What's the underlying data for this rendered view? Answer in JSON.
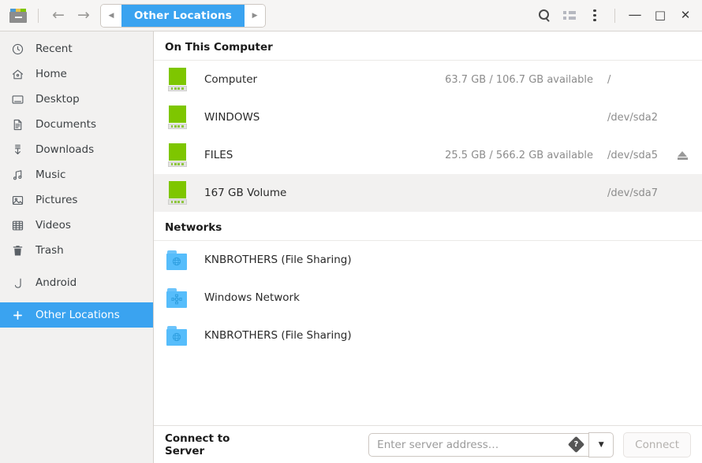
{
  "header": {
    "cabinet_icon": "file-cabinet-icon",
    "cabinet_tab_colors": [
      "#4a9ad4",
      "#e8c34a",
      "#7ec600"
    ],
    "back_arrow": "←",
    "forward_arrow": "→",
    "path_prev": "◀",
    "path_next": "▶",
    "breadcrumb": "Other Locations",
    "search_icon": "search-icon",
    "list_icon": "list-view-icon",
    "menu_icon": "menu-dots-icon",
    "minimize": "—",
    "maximize": "□",
    "close": "✕"
  },
  "sidebar": {
    "items": [
      {
        "label": "Recent",
        "icon": "clock-icon",
        "selected": false
      },
      {
        "label": "Home",
        "icon": "home-icon",
        "selected": false
      },
      {
        "label": "Desktop",
        "icon": "desktop-icon",
        "selected": false
      },
      {
        "label": "Documents",
        "icon": "document-icon",
        "selected": false
      },
      {
        "label": "Downloads",
        "icon": "download-icon",
        "selected": false
      },
      {
        "label": "Music",
        "icon": "music-icon",
        "selected": false
      },
      {
        "label": "Pictures",
        "icon": "picture-icon",
        "selected": false
      },
      {
        "label": "Videos",
        "icon": "video-icon",
        "selected": false
      },
      {
        "label": "Trash",
        "icon": "trash-icon",
        "selected": false
      },
      {
        "label": "Android",
        "icon": "phone-icon",
        "selected": false
      },
      {
        "label": "Other Locations",
        "icon": "plus-icon",
        "selected": true
      }
    ]
  },
  "main": {
    "sections": [
      {
        "title": "On This Computer",
        "rows": [
          {
            "name": "Computer",
            "size": "63.7 GB / 106.7 GB available",
            "device": "/",
            "icon": "drive-icon",
            "eject": false,
            "highlighted": false
          },
          {
            "name": "WINDOWS",
            "size": "",
            "device": "/dev/sda2",
            "icon": "drive-icon",
            "eject": false,
            "highlighted": false
          },
          {
            "name": "FILES",
            "size": "25.5 GB / 566.2 GB available",
            "device": "/dev/sda5",
            "icon": "drive-icon",
            "eject": true,
            "highlighted": false
          },
          {
            "name": "167 GB Volume",
            "size": "",
            "device": "/dev/sda7",
            "icon": "drive-icon",
            "eject": false,
            "highlighted": true
          }
        ]
      },
      {
        "title": "Networks",
        "rows": [
          {
            "name": "KNBROTHERS (File Sharing)",
            "size": "",
            "device": "",
            "icon": "network-folder-globe-icon",
            "eject": false,
            "highlighted": false
          },
          {
            "name": "Windows Network",
            "size": "",
            "device": "",
            "icon": "network-folder-nodes-icon",
            "eject": false,
            "highlighted": false
          },
          {
            "name": "KNBROTHERS (File Sharing)",
            "size": "",
            "device": "",
            "icon": "network-folder-globe-icon",
            "eject": false,
            "highlighted": false
          }
        ]
      }
    ]
  },
  "footer": {
    "title": "Connect to Server",
    "input_value": "",
    "input_placeholder": "Enter server address…",
    "help_icon": "help-icon",
    "help_glyph": "?",
    "dropdown_icon": "▼",
    "connect_label": "Connect"
  },
  "colors": {
    "accent": "#3aa3f0",
    "drive_green": "#7ec600",
    "network_blue": "#56bdfb",
    "sidebar_bg": "#f2f1f0",
    "header_bg": "#f6f5f4"
  }
}
